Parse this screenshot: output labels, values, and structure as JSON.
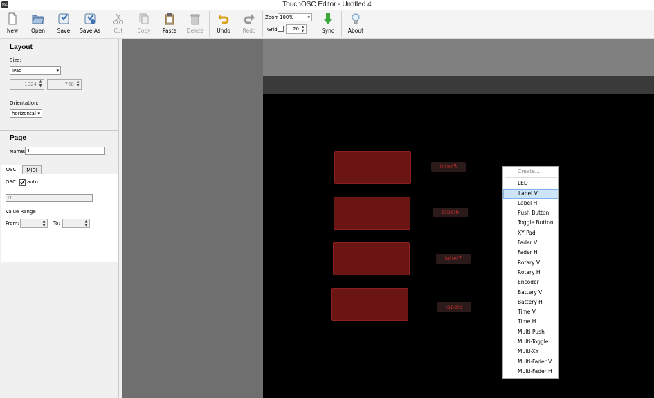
{
  "window": {
    "title": "TouchOSC Editor - Untitled 4",
    "app_icon_text": "OSC"
  },
  "toolbar": {
    "new": "New",
    "open": "Open",
    "save": "Save",
    "save_as": "Save As",
    "cut": "Cut",
    "copy": "Copy",
    "paste": "Paste",
    "delete": "Delete",
    "undo": "Undo",
    "redo": "Redo",
    "zoom_label": "Zoom",
    "zoom_value": "100%",
    "grid_label": "Grid",
    "grid_value": "20",
    "sync": "Sync",
    "about": "About"
  },
  "layout": {
    "heading": "Layout",
    "size_label": "Size:",
    "size_value": "iPad",
    "width": "1024",
    "height": "768",
    "orientation_label": "Orientation:",
    "orientation_value": "horizontal"
  },
  "page": {
    "heading": "Page",
    "name_label": "Name:",
    "name_value": "1",
    "tabs": [
      "OSC",
      "MIDI"
    ],
    "osc_label": "OSC:",
    "auto_label": "auto",
    "osc_path": "/1",
    "value_range_label": "Value Range",
    "from_label": "From:",
    "to_label": "To:"
  },
  "controls": {
    "labels": [
      "label5",
      "label6",
      "label7",
      "label8"
    ]
  },
  "context_menu": {
    "header": "Create...",
    "items": [
      "LED",
      "Label V",
      "Label H",
      "Push Button",
      "Toggle Button",
      "XY Pad",
      "Fader V",
      "Fader H",
      "Rotary V",
      "Rotary H",
      "Encoder",
      "Battery V",
      "Battery H",
      "Time V",
      "Time H",
      "Multi-Push",
      "Multi-Toggle",
      "Multi-XY",
      "Multi-Fader V",
      "Multi-Fader H"
    ],
    "selected": "Label V"
  },
  "colors": {
    "control_red": "#6b1414",
    "label_text": "#c0302b",
    "canvas_bg": "#000000",
    "selection": "#cde4f7"
  }
}
